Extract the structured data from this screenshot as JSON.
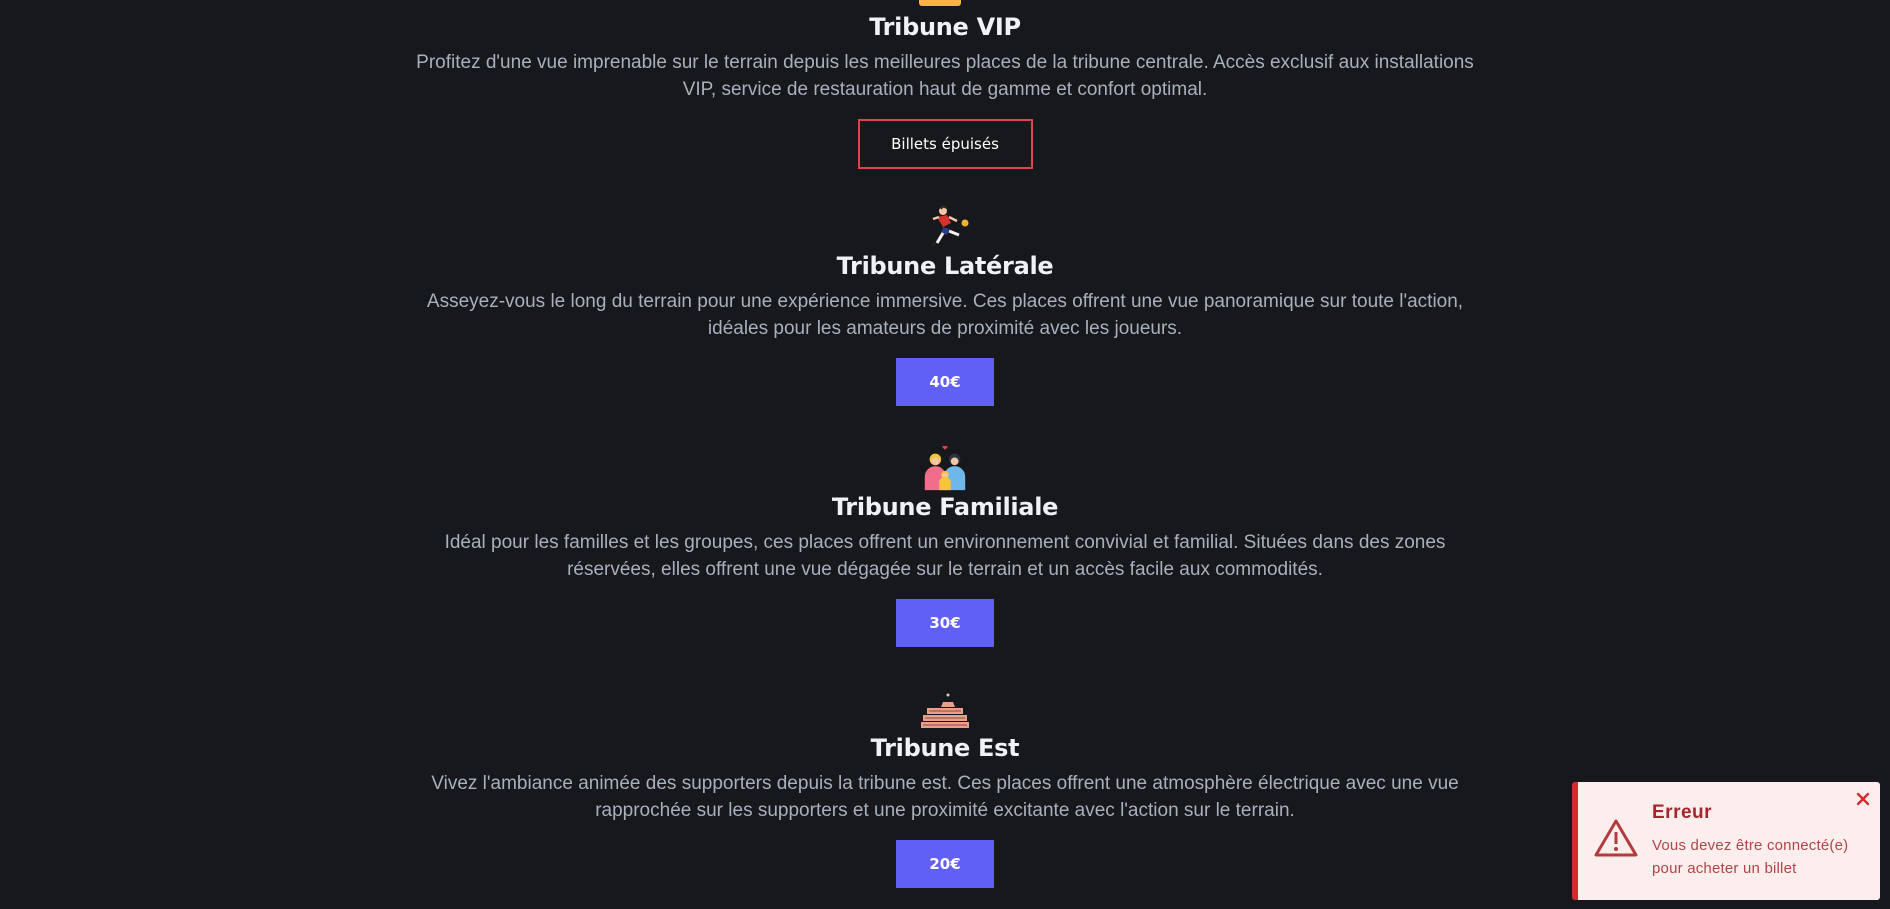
{
  "tribunes": [
    {
      "title": "Tribune VIP",
      "icon": "vip-icon",
      "description": "Profitez d'une vue imprenable sur le terrain depuis les meilleures places de la tribune centrale. Accès exclusif aux installations VIP, service de restauration haut de gamme et confort optimal.",
      "button_label": "Billets épuisés"
    },
    {
      "title": "Tribune Latérale",
      "icon": "football-player-icon",
      "description": "Asseyez-vous le long du terrain pour une expérience immersive. Ces places offrent une vue panoramique sur toute l'action, idéales pour les amateurs de proximité avec les joueurs.",
      "button_label": "40€"
    },
    {
      "title": "Tribune Familiale",
      "icon": "family-icon",
      "description": "Idéal pour les familles et les groupes, ces places offrent un environnement convivial et familial. Situées dans des zones réservées, elles offrent une vue dégagée sur le terrain et un accès facile aux commodités.",
      "button_label": "30€"
    },
    {
      "title": "Tribune Est",
      "icon": "bleachers-icon",
      "description": "Vivez l'ambiance animée des supporters depuis la tribune est. Ces places offrent une atmosphère électrique avec une vue rapprochée sur les supporters et une proximité excitante avec l'action sur le terrain.",
      "button_label": "20€"
    }
  ],
  "toast": {
    "title": "Erreur",
    "message": "Vous devez être connecté(e) pour acheter un billet",
    "icon": "warning-icon",
    "close_icon": "close-icon"
  },
  "colors": {
    "background": "#16181c",
    "accent": "#6060f7",
    "soldout_border": "#e2434b",
    "toast_bg": "#fdeeee",
    "toast_accent": "#d32a32"
  }
}
